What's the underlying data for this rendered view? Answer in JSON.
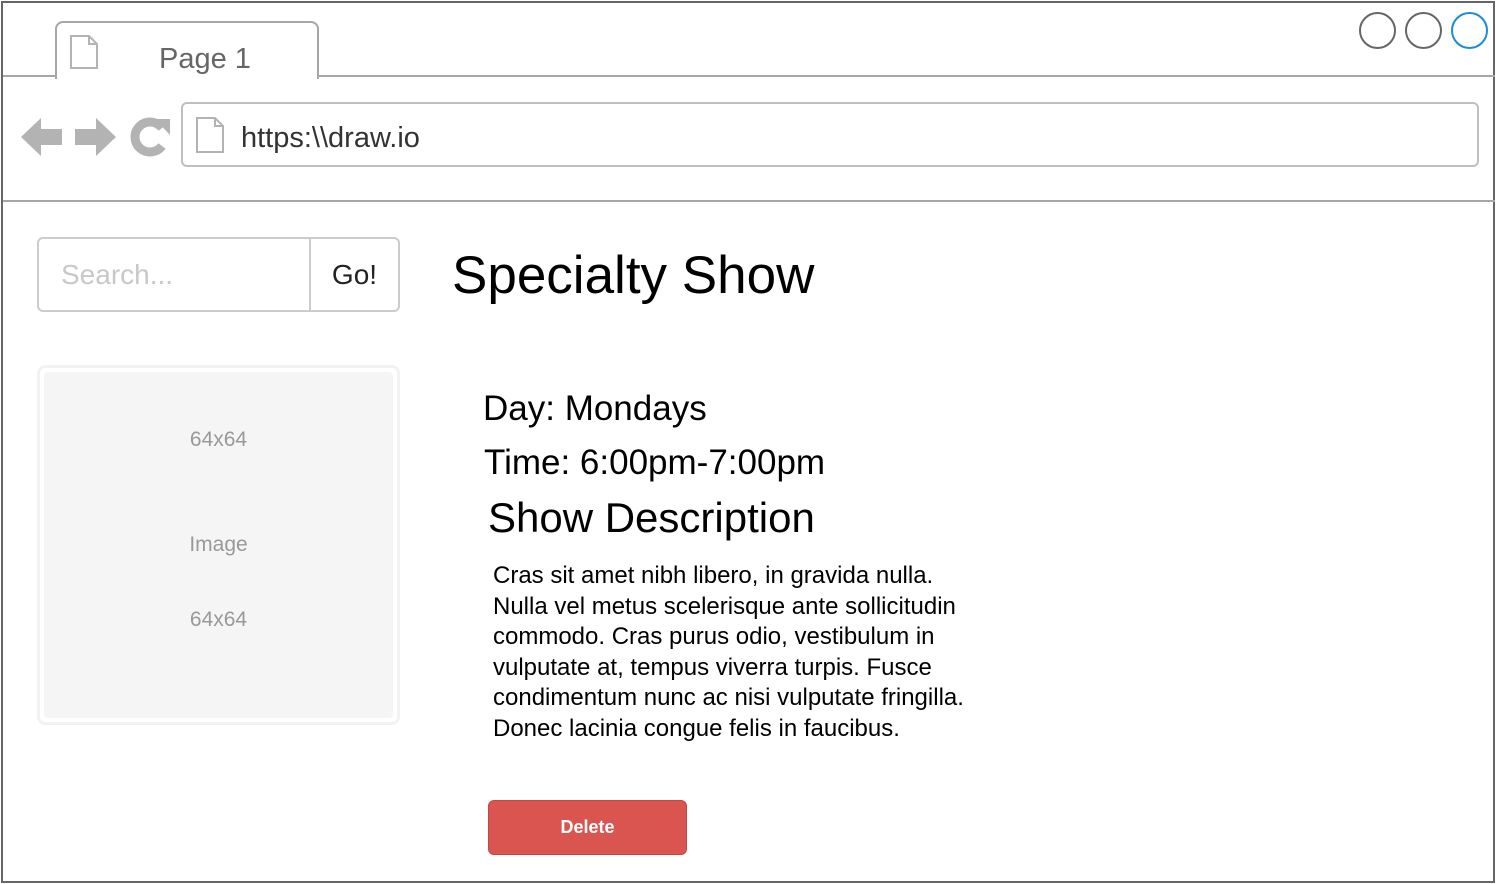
{
  "browser": {
    "tab_label": "Page 1",
    "url": "https:\\\\draw.io"
  },
  "search": {
    "placeholder": "Search...",
    "go_label": "Go!"
  },
  "image_placeholder": {
    "size_top": "64x64",
    "label": "Image",
    "size_bottom": "64x64"
  },
  "show": {
    "title": "Specialty Show",
    "day": "Day: Mondays",
    "time": "Time: 6:00pm-7:00pm",
    "description_heading": "Show Description",
    "description": "Cras sit amet nibh libero, in gravida nulla. Nulla vel metus scelerisque ante sollicitudin commodo. Cras purus odio, vestibulum in vulputate at, tempus viverra turpis. Fusce condimentum nunc ac nisi vulputate fringilla. Donec lacinia congue felis in faucibus.",
    "delete_label": "Delete"
  },
  "colors": {
    "delete_button": "#db5550",
    "window_button_accent": "#1a8cd8",
    "nav_icons": "#b3b3b3"
  }
}
